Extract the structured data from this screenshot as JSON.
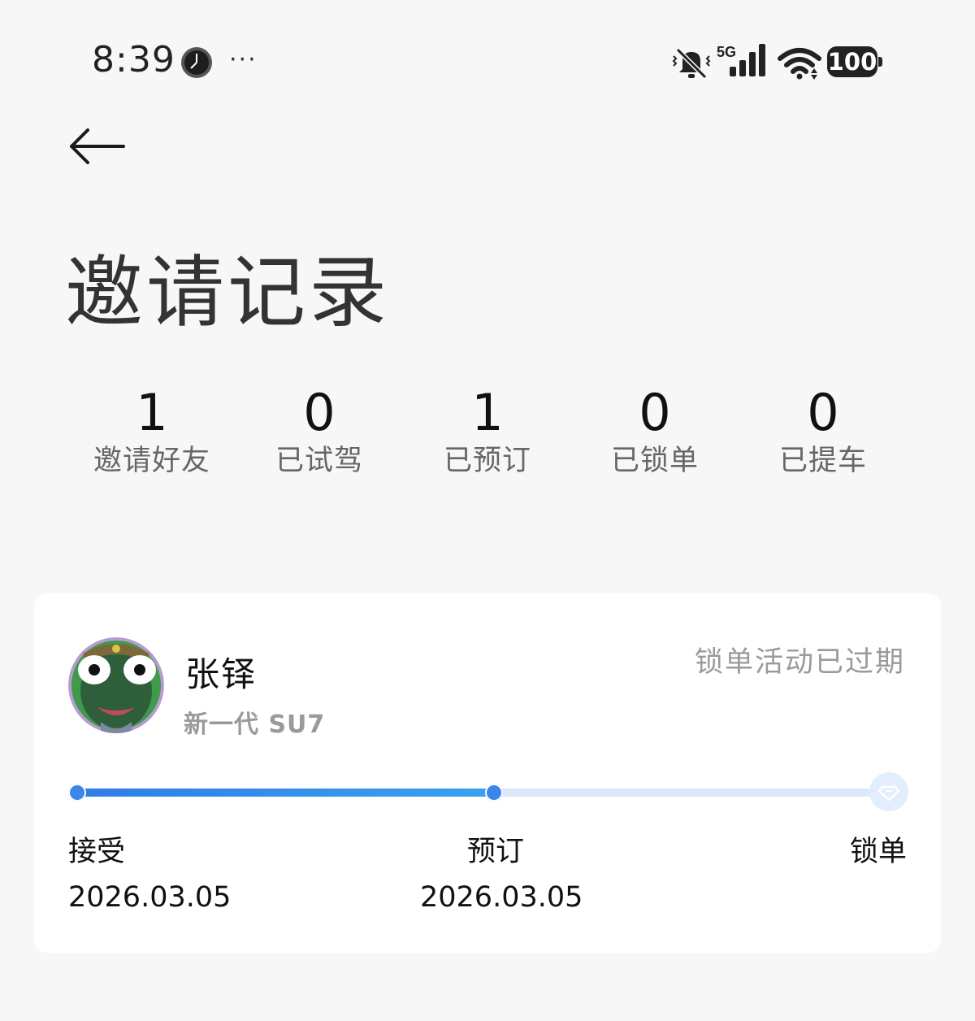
{
  "status_bar": {
    "time": "8:39",
    "clock_icon": "clock-icon",
    "more": "···",
    "network": "5G",
    "battery": "100",
    "icons": [
      "mute-icon",
      "signal-icon",
      "wifi-icon",
      "battery-icon"
    ]
  },
  "header": {
    "back_icon": "arrow-left-icon",
    "title": "邀请记录"
  },
  "stats": [
    {
      "value": "1",
      "label": "邀请好友"
    },
    {
      "value": "0",
      "label": "已试驾"
    },
    {
      "value": "1",
      "label": "已预订"
    },
    {
      "value": "0",
      "label": "已锁单"
    },
    {
      "value": "0",
      "label": "已提车"
    }
  ],
  "record": {
    "name": "张铎",
    "model": "新一代 SU7",
    "status": "锁单活动已过期",
    "progress_fraction": 0.5,
    "stages": [
      {
        "name": "接受",
        "date": "2026.03.05"
      },
      {
        "name": "预订",
        "date": "2026.03.05"
      },
      {
        "name": "锁单",
        "date": ""
      }
    ],
    "colors": {
      "progress": "#3a86ea",
      "track": "#dce9fb"
    }
  }
}
